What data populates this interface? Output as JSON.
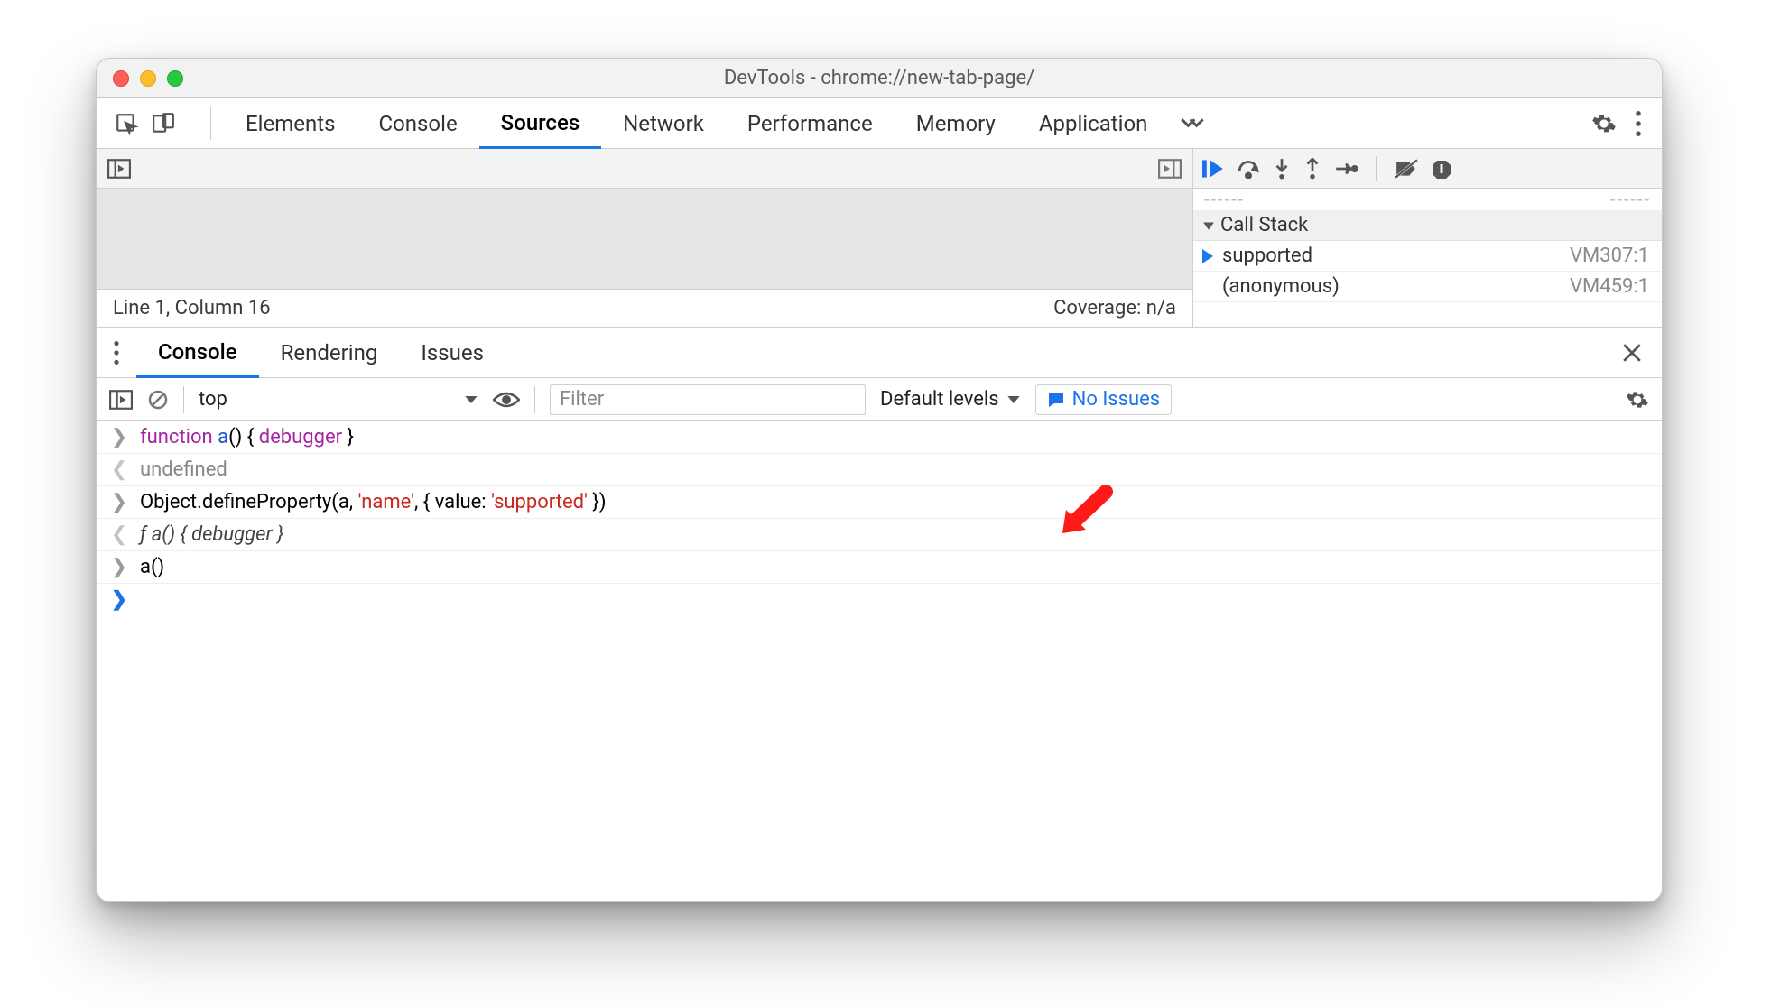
{
  "window": {
    "title": "DevTools - chrome://new-tab-page/"
  },
  "mainTabs": {
    "elements": "Elements",
    "console": "Console",
    "sources": "Sources",
    "network": "Network",
    "performance": "Performance",
    "memory": "Memory",
    "application": "Application"
  },
  "sources": {
    "status_line": "Line 1, Column 16",
    "coverage": "Coverage: n/a"
  },
  "callStack": {
    "header": "Call Stack",
    "frames": [
      {
        "name": "supported",
        "location": "VM307:1"
      },
      {
        "name": "(anonymous)",
        "location": "VM459:1"
      }
    ]
  },
  "drawerTabs": {
    "console": "Console",
    "rendering": "Rendering",
    "issues": "Issues"
  },
  "consoleToolbar": {
    "context": "top",
    "filter_placeholder": "Filter",
    "levels": "Default levels",
    "no_issues": "No Issues"
  },
  "consoleLog": {
    "line1_kw1": "function",
    "line1_fn": "a",
    "line1_paren": "() { ",
    "line1_kw2": "debugger",
    "line1_close": " }",
    "line2": "undefined",
    "line3_a": "Object.defineProperty(a, ",
    "line3_str1": "'name'",
    "line3_b": ", { value: ",
    "line3_str2": "'supported'",
    "line3_c": " })",
    "line4_sym": "ƒ ",
    "line4_rest": "a() { debugger }",
    "line5": "a()"
  }
}
